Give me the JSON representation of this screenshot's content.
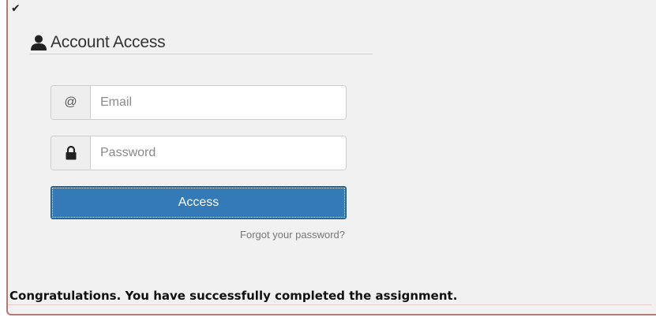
{
  "status": {
    "check_glyph": "✔"
  },
  "panel": {
    "title": "Account Access",
    "icon": "user-icon"
  },
  "form": {
    "email": {
      "addon": "@",
      "placeholder": "Email",
      "value": ""
    },
    "password": {
      "addon_icon": "lock-icon",
      "placeholder": "Password",
      "value": ""
    },
    "submit_label": "Access",
    "forgot_label": "Forgot your password?"
  },
  "footer": {
    "message": "Congratulations. You have successfully completed the assignment."
  },
  "colors": {
    "primary": "#337ab7",
    "frame_border": "#b57a78",
    "background": "#f1f1f1"
  }
}
